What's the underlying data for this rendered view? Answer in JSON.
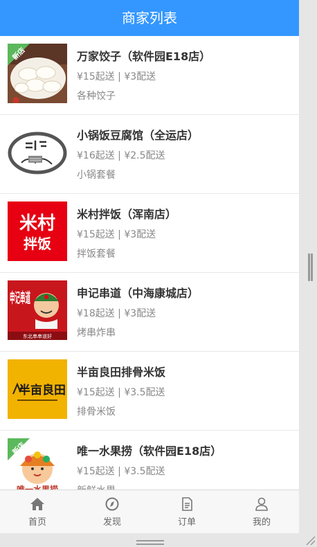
{
  "header": {
    "title": "商家列表"
  },
  "new_badge": "新店",
  "shops": [
    {
      "name": "万家饺子（软件园E18店）",
      "meta": "¥15起送 | ¥3配送",
      "desc": "各种饺子",
      "is_new": true,
      "logo": "dumplings-photo"
    },
    {
      "name": "小锅饭豆腐馆（全运店）",
      "meta": "¥16起送 | ¥2.5配送",
      "desc": "小锅套餐",
      "is_new": false,
      "logo": "xiaoguofan-logo"
    },
    {
      "name": "米村拌饭（浑南店）",
      "meta": "¥15起送 | ¥3配送",
      "desc": "拌饭套餐",
      "is_new": false,
      "logo": "micun-logo",
      "logo_text": [
        "米村",
        "拌饭"
      ]
    },
    {
      "name": "申记串道（中海康城店）",
      "meta": "¥18起送 | ¥3配送",
      "desc": "烤串炸串",
      "is_new": false,
      "logo": "shenji-logo",
      "logo_text": [
        "申记串道",
        "东北串串道好"
      ]
    },
    {
      "name": "半亩良田排骨米饭",
      "meta": "¥15起送 | ¥3.5配送",
      "desc": "排骨米饭",
      "is_new": false,
      "logo": "banmu-logo",
      "logo_text": [
        "半亩良田"
      ]
    },
    {
      "name": "唯一水果捞（软件园E18店）",
      "meta": "¥15起送 | ¥3.5配送",
      "desc": "新鲜水果",
      "is_new": true,
      "logo": "fruit-logo",
      "logo_text": [
        "唯一水果捞"
      ]
    }
  ],
  "tabbar": [
    {
      "label": "首页",
      "icon": "home-icon"
    },
    {
      "label": "发现",
      "icon": "compass-icon"
    },
    {
      "label": "订单",
      "icon": "order-icon"
    },
    {
      "label": "我的",
      "icon": "user-icon"
    }
  ],
  "colors": {
    "header_bg": "#3497ff",
    "badge": "#5cb85c",
    "micun_red": "#e60012",
    "shenji_red": "#c8161d",
    "banmu_yellow": "#f2b200"
  }
}
